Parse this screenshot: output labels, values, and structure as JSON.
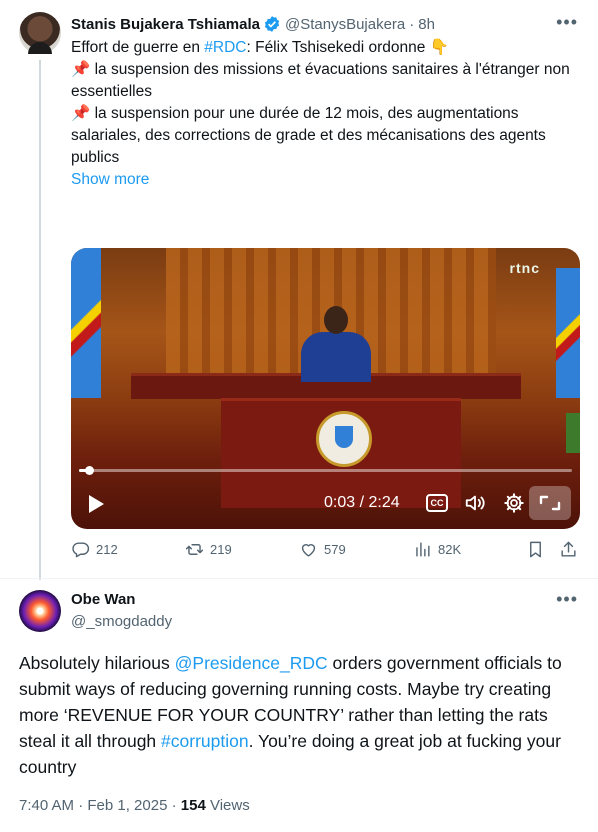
{
  "original_tweet": {
    "author_name": "Stanis Bujakera Tshiamala",
    "handle": "@StanysBujakera",
    "separator": "·",
    "time": "8h",
    "line1_prefix": "Effort de guerre en ",
    "line1_hashtag": "#RDC",
    "line1_suffix": ": Félix Tshisekedi ordonne 👇",
    "point1": "📌 la suspension des missions et évacuations sanitaires à l'étranger non essentielles",
    "point2": "📌 la suspension pour une durée de 12 mois, des augmentations salariales, des corrections de grade et des mécanisations des agents publics",
    "show_more": "Show more",
    "video": {
      "channel_logo": "rtnc",
      "current_time": "0:03",
      "time_separator": " / ",
      "duration": "2:24",
      "cc_label": "CC",
      "progress_fraction": 0.021
    },
    "metrics": {
      "replies": "212",
      "reposts": "219",
      "likes": "579",
      "views": "82K"
    }
  },
  "reply_tweet": {
    "author_name": "Obe Wan",
    "handle": "@_smogdaddy",
    "text_part1": "Absolutely hilarious ",
    "mention": "@Presidence_RDC",
    "text_part2": " orders government officials to submit ways of reducing governing running costs. Maybe try creating more ‘REVENUE FOR YOUR COUNTRY’ rather than letting the rats  steal it all through ",
    "hashtag": "#corruption",
    "text_part3": ". You’re doing a great job at fucking your country",
    "timestamp": "7:40 AM · Feb 1, 2025 · ",
    "views_count": "154",
    "views_label": " Views"
  },
  "colors": {
    "link": "#1d9bf0",
    "secondary_text": "#536471",
    "primary_text": "#0f1419"
  }
}
